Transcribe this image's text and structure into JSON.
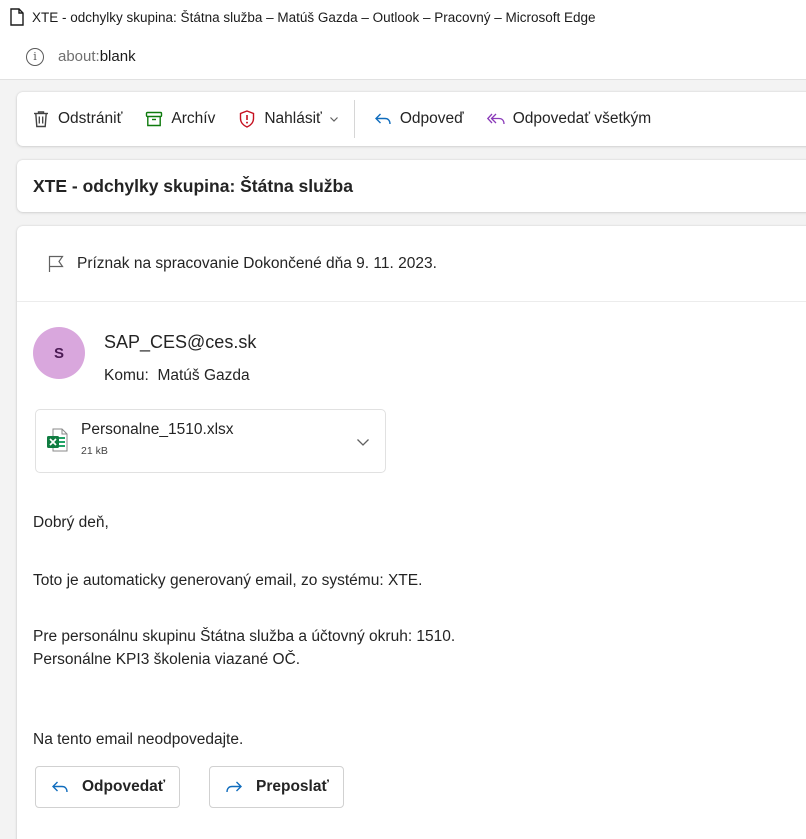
{
  "window": {
    "title": "XTE - odchylky skupina: Štátna služba – Matúš Gazda – Outlook – Pracovný – Microsoft Edge"
  },
  "address_bar": {
    "url_scheme": "about:",
    "url_host": "blank"
  },
  "toolbar": {
    "delete_label": "Odstrániť",
    "archive_label": "Archív",
    "report_label": "Nahlásiť",
    "reply_label": "Odpoveď",
    "reply_all_label": "Odpovedať všetkým"
  },
  "message": {
    "subject": "XTE - odchylky skupina: Štátna služba",
    "flag_status": "Príznak na spracovanie Dokončené dňa 9. 11. 2023.",
    "sender": {
      "initial": "S",
      "address": "SAP_CES@ces.sk",
      "avatar_color": "#d9a7dd"
    },
    "recipient": {
      "label": "Komu:",
      "name": "Matúš Gazda"
    },
    "attachment": {
      "name": "Personalne_1510.xlsx",
      "size": "21 kB",
      "icon": "excel-file-icon"
    },
    "body": {
      "greeting": "Dobrý deň,",
      "line1": "Toto je automaticky generovaný email, zo systému: XTE.",
      "line2": "Pre personálnu skupinu Štátna služba a účtovný okruh: 1510.",
      "line3": "Personálne KPI3 školenia viazané OČ.",
      "line4": "Na tento email neodpovedajte."
    },
    "actions": {
      "reply_label": "Odpovedať",
      "forward_label": "Preposlať"
    }
  },
  "colors": {
    "accent": "#0f6cbd",
    "report_red": "#c50f1f",
    "archive_green": "#0e7a0d",
    "excel_green": "#107c41"
  }
}
